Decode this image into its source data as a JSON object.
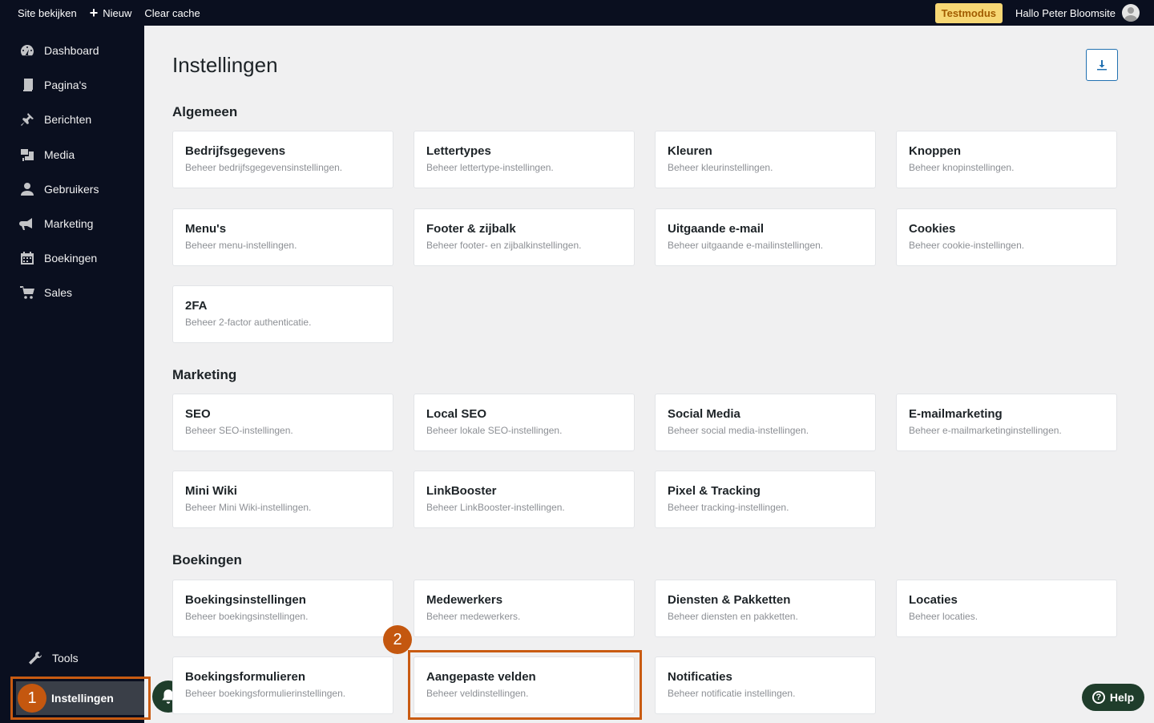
{
  "topbar": {
    "view_site": "Site bekijken",
    "new": "Nieuw",
    "clear_cache": "Clear cache",
    "test_mode": "Testmodus",
    "greeting": "Hallo Peter Bloomsite"
  },
  "sidebar": {
    "items": [
      {
        "label": "Dashboard",
        "icon": "dashboard-icon"
      },
      {
        "label": "Pagina's",
        "icon": "pages-icon"
      },
      {
        "label": "Berichten",
        "icon": "pin-icon"
      },
      {
        "label": "Media",
        "icon": "media-icon"
      },
      {
        "label": "Gebruikers",
        "icon": "user-icon"
      },
      {
        "label": "Marketing",
        "icon": "megaphone-icon"
      },
      {
        "label": "Boekingen",
        "icon": "calendar-icon"
      },
      {
        "label": "Sales",
        "icon": "cart-icon"
      }
    ],
    "tools": "Tools",
    "settings": "Instellingen"
  },
  "steps": {
    "one": "1",
    "two": "2"
  },
  "main": {
    "title": "Instellingen",
    "sections": [
      {
        "title": "Algemeen",
        "cards": [
          {
            "title": "Bedrijfsgegevens",
            "desc": "Beheer bedrijfsgegevensinstellingen."
          },
          {
            "title": "Lettertypes",
            "desc": "Beheer lettertype-instellingen."
          },
          {
            "title": "Kleuren",
            "desc": "Beheer kleurinstellingen."
          },
          {
            "title": "Knoppen",
            "desc": "Beheer knopinstellingen."
          },
          {
            "title": "Menu's",
            "desc": "Beheer menu-instellingen."
          },
          {
            "title": "Footer & zijbalk",
            "desc": "Beheer footer- en zijbalkinstellingen."
          },
          {
            "title": "Uitgaande e-mail",
            "desc": "Beheer uitgaande e-mailinstellingen."
          },
          {
            "title": "Cookies",
            "desc": "Beheer cookie-instellingen."
          },
          {
            "title": "2FA",
            "desc": "Beheer 2-factor authenticatie."
          }
        ]
      },
      {
        "title": "Marketing",
        "cards": [
          {
            "title": "SEO",
            "desc": "Beheer SEO-instellingen."
          },
          {
            "title": "Local SEO",
            "desc": "Beheer lokale SEO-instellingen."
          },
          {
            "title": "Social Media",
            "desc": "Beheer social media-instellingen."
          },
          {
            "title": "E-mailmarketing",
            "desc": "Beheer e-mailmarketinginstellingen."
          },
          {
            "title": "Mini Wiki",
            "desc": "Beheer Mini Wiki-instellingen."
          },
          {
            "title": "LinkBooster",
            "desc": "Beheer LinkBooster-instellingen."
          },
          {
            "title": "Pixel & Tracking",
            "desc": "Beheer tracking-instellingen."
          }
        ]
      },
      {
        "title": "Boekingen",
        "cards": [
          {
            "title": "Boekingsinstellingen",
            "desc": "Beheer boekingsinstellingen."
          },
          {
            "title": "Medewerkers",
            "desc": "Beheer medewerkers."
          },
          {
            "title": "Diensten & Pakketten",
            "desc": "Beheer diensten en pakketten."
          },
          {
            "title": "Locaties",
            "desc": "Beheer locaties."
          },
          {
            "title": "Boekingsformulieren",
            "desc": "Beheer boekingsformulierinstellingen."
          },
          {
            "title": "Aangepaste velden",
            "desc": "Beheer veldinstellingen."
          },
          {
            "title": "Notificaties",
            "desc": "Beheer notificatie instellingen."
          }
        ]
      }
    ]
  },
  "help": "Help",
  "colors": {
    "sidebar": "#0a0f1f",
    "highlight": "#c95b12",
    "accent": "#2271b1",
    "help_bg": "#1f3d2b"
  }
}
